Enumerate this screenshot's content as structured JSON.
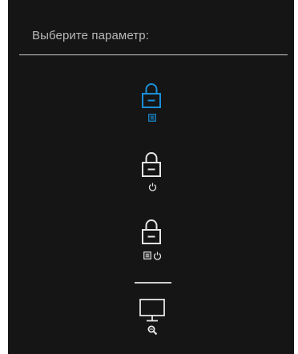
{
  "prompt": "Выберите параметр:",
  "colors": {
    "background": "#151515",
    "text": "#b9b9b9",
    "icon_default": "#e6e6e6",
    "icon_selected": "#1a8fd8"
  },
  "options": [
    {
      "id": "menu-lock",
      "icons": [
        "lock-icon",
        "menu-icon"
      ],
      "selected": true
    },
    {
      "id": "power-lock",
      "icons": [
        "lock-icon",
        "power-icon"
      ],
      "selected": false
    },
    {
      "id": "menu-power-lock",
      "icons": [
        "lock-icon",
        "menu-icon",
        "power-icon"
      ],
      "selected": false
    },
    {
      "id": "display-diagnostics",
      "icons": [
        "monitor-icon",
        "magnifier-wrench-icon"
      ],
      "selected": false
    }
  ]
}
